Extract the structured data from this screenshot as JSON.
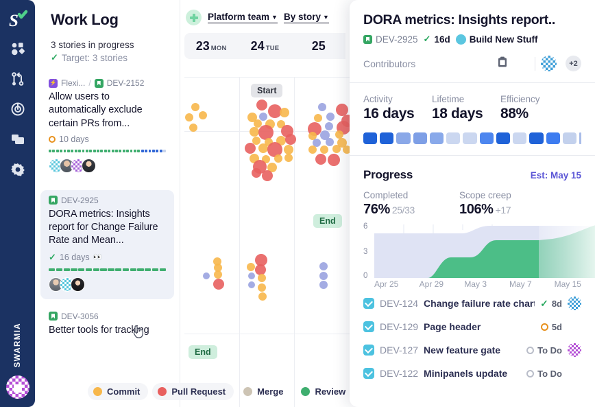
{
  "nav": {
    "logo": "swarmia-logo-icon",
    "items": [
      {
        "name": "insights-icon",
        "label": "Insights"
      },
      {
        "name": "pull-requests-icon",
        "label": "Pull requests"
      },
      {
        "name": "targets-icon",
        "label": "Targets"
      },
      {
        "name": "boards-icon",
        "label": "Boards"
      },
      {
        "name": "settings-icon",
        "label": "Settings"
      }
    ],
    "wordmark": "SWARMIA"
  },
  "worklog": {
    "title": "Work Log",
    "subtitle": "3 stories in progress",
    "target": "Target: 3 stories",
    "stories": [
      {
        "project": "Flexi...",
        "key": "DEV-2152",
        "title": "Allow users to automatically exclude certain PRs from...",
        "days": "10 days",
        "status_icon": "open-ring-icon",
        "selected": false,
        "progress_colors": [
          "#3fae6f",
          "#3fae6f",
          "#3fae6f",
          "#3fae6f",
          "#3fae6f",
          "#3fae6f",
          "#3fae6f",
          "#3fae6f",
          "#3fae6f",
          "#3fae6f",
          "#3fae6f",
          "#3fae6f",
          "#3fae6f",
          "#3fae6f",
          "#3fae6f",
          "#3fae6f",
          "#3fae6f",
          "#3fae6f",
          "#3fae6f",
          "#3fae6f",
          "#3fae6f",
          "#3fae6f",
          "#3fae6f",
          "#3fae6f",
          "#3fae6f",
          "#3066d6",
          "#3066d6",
          "#3066d6",
          "#3066d6",
          "#3066d6",
          "#3066d6",
          "#c9d4ea"
        ],
        "avatars": [
          "cyan",
          "photo1",
          "violet",
          "photo2"
        ]
      },
      {
        "project": "",
        "key": "DEV-2925",
        "title": "DORA metrics: Insights report for Change Failure Rate and Mean...",
        "days": "16 days",
        "status_icon": "check-icon",
        "watchers": "👀",
        "selected": true,
        "progress_colors": [
          "#3fae6f",
          "#3fae6f",
          "#3fae6f",
          "#3fae6f",
          "#3fae6f",
          "#3fae6f",
          "#3fae6f",
          "#3fae6f",
          "#3fae6f",
          "#3fae6f",
          "#3fae6f",
          "#3fae6f",
          "#3fae6f",
          "#3fae6f",
          "#3fae6f",
          "#3fae6f"
        ],
        "avatars": [
          "photo4",
          "cyan",
          "photo3"
        ]
      },
      {
        "project": "",
        "key": "DEV-3056",
        "title": "Better tools for tracking",
        "days": "",
        "selected": false
      }
    ]
  },
  "timeline": {
    "team": "Platform team",
    "grouping": "By story",
    "dates": [
      {
        "num": "23",
        "dow": "MON"
      },
      {
        "num": "24",
        "dow": "TUE"
      },
      {
        "num": "25",
        "dow": ""
      }
    ],
    "pills": [
      {
        "label": "Start",
        "type": "start"
      },
      {
        "label": "End",
        "type": "end"
      },
      {
        "label": "End",
        "type": "end"
      }
    ],
    "legend": [
      {
        "label": "Commit",
        "color": "#f7b74b"
      },
      {
        "label": "Pull Request",
        "color": "#e8605f"
      },
      {
        "label": "Merge",
        "color": "#cdc4b4"
      },
      {
        "label": "Review",
        "color": "#3fae6f"
      }
    ]
  },
  "panel": {
    "title": "DORA metrics: Insights report..",
    "key": "DEV-2925",
    "duration": "16d",
    "board": "Build New Stuff",
    "contributors_label": "Contributors",
    "contributors_extra": "+2",
    "stats": [
      {
        "key": "Activity",
        "value": "16 days"
      },
      {
        "key": "Lifetime",
        "value": "18 days"
      },
      {
        "key": "Efficiency",
        "value": "88%"
      }
    ],
    "activity_bar": [
      "#1f62d8",
      "#1f62d8",
      "#8aa8e8",
      "#7e9fe6",
      "#89a9ea",
      "#cbd7f0",
      "#cbd7f0",
      "#4d86ef",
      "#1f62d8",
      "#cbd7f0",
      "#1f62d8",
      "#3d7cf0",
      "#c3d1ed",
      "#a9bde9"
    ],
    "progress": {
      "heading": "Progress",
      "estimate": "Est: May 15",
      "completed_label": "Completed",
      "completed_value": "76%",
      "completed_detail": "25/33",
      "scope_label": "Scope creep",
      "scope_value": "106%",
      "scope_detail": "+17"
    },
    "tasks": [
      {
        "key": "DEV-124",
        "name": "Change failure rate chart",
        "status": "8d",
        "status_icon": "check-icon",
        "avatar": "swarm"
      },
      {
        "key": "DEV-129",
        "name": "Page header",
        "status": "5d",
        "status_icon": "open-ring-icon",
        "avatar": "photo"
      },
      {
        "key": "DEV-127",
        "name": "New feature gate",
        "status": "To Do",
        "status_icon": "grey-ring-icon",
        "avatar": "violet"
      },
      {
        "key": "DEV-122",
        "name": "Minipanels update",
        "status": "To Do",
        "status_icon": "grey-ring-icon",
        "avatar": "photo"
      }
    ]
  },
  "chart_data": {
    "type": "area",
    "title": "Progress",
    "xlabel": "",
    "ylabel": "",
    "ylim": [
      0,
      6
    ],
    "yticks": [
      0,
      3,
      6
    ],
    "x": [
      "Apr 25",
      "Apr 29",
      "May 3",
      "May 7",
      "May 15"
    ],
    "grid": true,
    "legend": "none",
    "series": [
      {
        "name": "Scope",
        "color": "#dfe3f4",
        "values": [
          5,
          5,
          5,
          5.2,
          6,
          6,
          6
        ]
      },
      {
        "name": "Completed",
        "color": "#4cbe87",
        "values": [
          0,
          0,
          2.3,
          2.4,
          4.5,
          4.5,
          6
        ]
      }
    ],
    "forecast_start": "May 7"
  }
}
